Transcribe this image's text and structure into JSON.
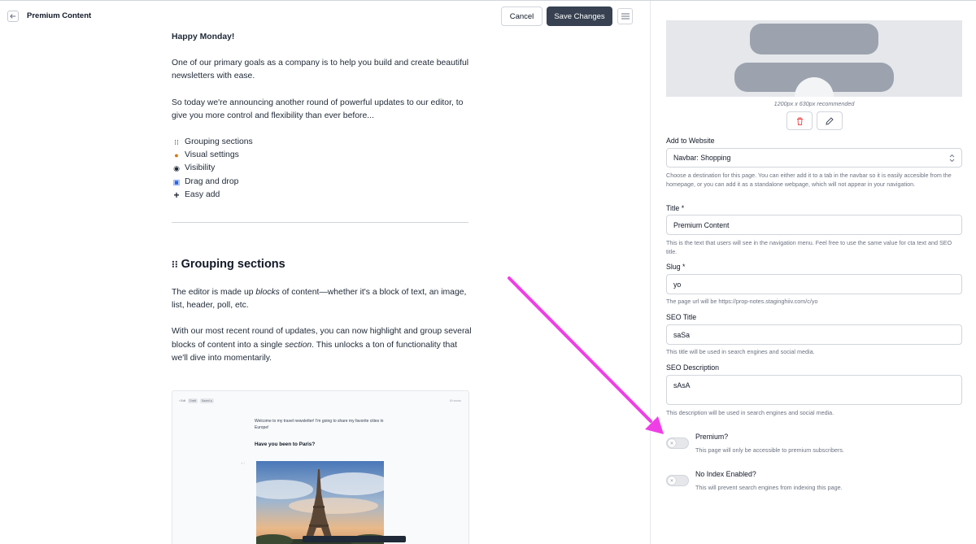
{
  "header": {
    "title": "Premium Content",
    "cancel_label": "Cancel",
    "save_label": "Save Changes"
  },
  "article": {
    "greeting": "Happy Monday!",
    "para1": "One of our primary goals as a company is to help you build and create beautiful newsletters with ease.",
    "para2": "So today we're announcing another round of powerful updates to our editor, to give you more control and flexibility than ever before...",
    "features": [
      {
        "icon": "grouping-icon",
        "label": "Grouping sections"
      },
      {
        "icon": "palette-icon",
        "label": "Visual settings"
      },
      {
        "icon": "eye-icon",
        "label": "Visibility"
      },
      {
        "icon": "drag-icon",
        "label": "Drag and drop"
      },
      {
        "icon": "plus-icon",
        "label": "Easy add"
      }
    ],
    "section_heading": "Grouping sections",
    "section_para1_a": "The editor is made up ",
    "section_para1_em": "blocks",
    "section_para1_b": " of content—whether it's a block of text, an image, list, header, poll, etc.",
    "section_para2_a": "With our most recent round of updates, you can now highlight and group several blocks of content into a single ",
    "section_para2_em": "section",
    "section_para2_b": ". This unlocks a ton of functionality that we'll dive into momentarily.",
    "embed": {
      "back": "‹ Edit",
      "pill1": "Draft",
      "pill2": "Saved ●",
      "words": "50 words",
      "text": "Welcome to my travel newsletter! I'm going to share my favorite cities in Europe!",
      "heading": "Have you been to Paris?"
    }
  },
  "panel": {
    "thumb_hint": "1200px x 630px recommended",
    "add_to_website": {
      "label": "Add to Website",
      "value": "Navbar: Shopping",
      "help": "Choose a destination for this page. You can either add it to a tab in the navbar so it is easily accesible from the homepage, or you can add it as a standalone webpage, which will not appear in your navigation."
    },
    "title": {
      "label": "Title *",
      "value": "Premium Content",
      "help": "This is the text that users will see in the navigation menu. Feel free to use the same value for cta text and SEO title."
    },
    "slug": {
      "label": "Slug *",
      "value": "yo",
      "help": "The page url will be https://prop-notes.staginghiiv.com/c/yo"
    },
    "seo_title": {
      "label": "SEO Title",
      "value": "saSa",
      "help": "This title will be used in search engines and social media."
    },
    "seo_description": {
      "label": "SEO Description",
      "value": "sAsA",
      "help": "This description will be used in search engines and social media."
    },
    "premium": {
      "label": "Premium?",
      "help": "This page will only be accessible to premium subscribers.",
      "enabled": false
    },
    "no_index": {
      "label": "No Index Enabled?",
      "help": "This will prevent search engines from indexing this page.",
      "enabled": false
    }
  },
  "colors": {
    "primary_button": "#374151",
    "annotation_arrow": "#f03ee6",
    "delete_icon": "#ef4444"
  }
}
